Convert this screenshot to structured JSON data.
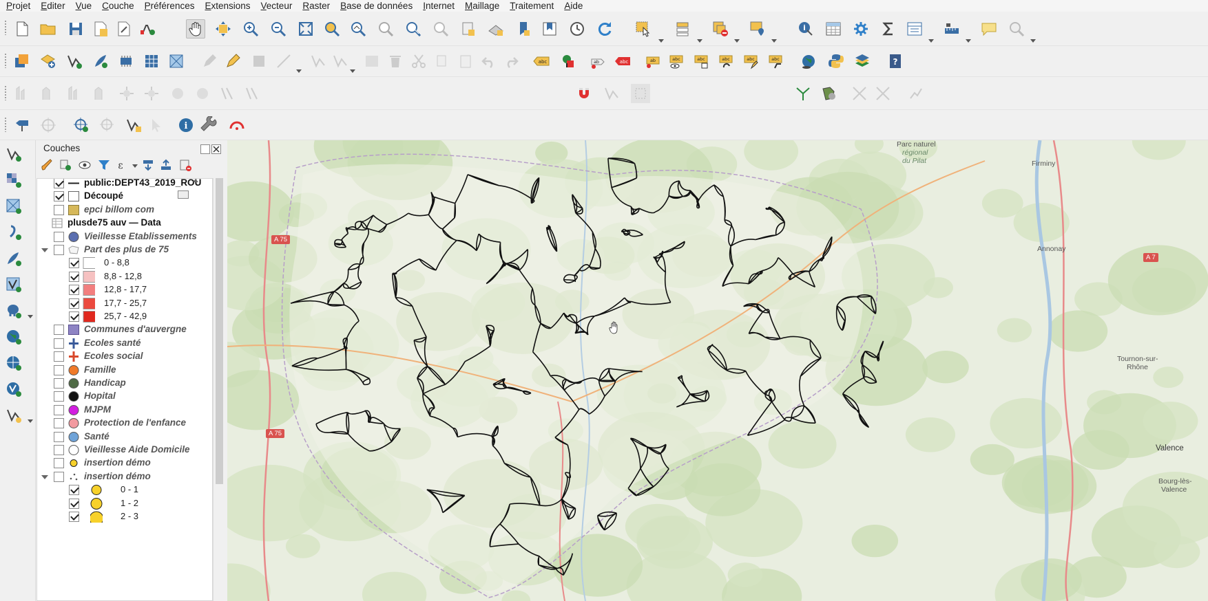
{
  "menu": [
    {
      "first": "P",
      "rest": "rojet"
    },
    {
      "first": "E",
      "rest": "diter"
    },
    {
      "first": "V",
      "rest": "ue"
    },
    {
      "first": "C",
      "rest": "ouche"
    },
    {
      "first": "P",
      "rest": "références"
    },
    {
      "first": "E",
      "rest": "xtensions"
    },
    {
      "first": "V",
      "rest": "ecteur"
    },
    {
      "first": "R",
      "rest": "aster"
    },
    {
      "first": "B",
      "rest": "ase de données"
    },
    {
      "first": "I",
      "rest": "nternet"
    },
    {
      "first": "M",
      "rest": "aillage"
    },
    {
      "first": "T",
      "rest": "raitement"
    },
    {
      "first": "A",
      "rest": "ide"
    }
  ],
  "snapping": {
    "tolerance": "12",
    "unit": "px"
  },
  "layers_panel": {
    "title": "Couches"
  },
  "layers": [
    {
      "label": "public:DEPT43_2019_ROU",
      "checked": true,
      "style": "b",
      "sym": "line",
      "indent": 0
    },
    {
      "label": "Découpé",
      "checked": true,
      "style": "b",
      "sym": "emptybox",
      "indent": 0
    },
    {
      "label": "epci billom com",
      "checked": false,
      "style": "it",
      "sym": "box-khaki",
      "indent": 0
    },
    {
      "label": "plusde75 auv — Data",
      "checked": null,
      "style": "b",
      "sym": "table",
      "indent": 0
    },
    {
      "label": "Vieillesse Etablissements",
      "checked": false,
      "style": "it",
      "sym": "dot-blue",
      "indent": 0
    },
    {
      "label": "Part des plus de 75",
      "checked": false,
      "style": "it",
      "sym": "poly-white",
      "indent": 0,
      "expanded": true
    },
    {
      "label": "0 - 8,8",
      "checked": true,
      "style": "n",
      "sym": "swatch-0",
      "indent": 1
    },
    {
      "label": "8,8 - 12,8",
      "checked": true,
      "style": "n",
      "sym": "swatch-1",
      "indent": 1
    },
    {
      "label": "12,8 - 17,7",
      "checked": true,
      "style": "n",
      "sym": "swatch-2",
      "indent": 1
    },
    {
      "label": "17,7 - 25,7",
      "checked": true,
      "style": "n",
      "sym": "swatch-3",
      "indent": 1
    },
    {
      "label": "25,7 - 42,9",
      "checked": true,
      "style": "n",
      "sym": "swatch-4",
      "indent": 1
    },
    {
      "label": "Communes d'auvergne",
      "checked": false,
      "style": "it",
      "sym": "box-purple",
      "indent": 0
    },
    {
      "label": "Ecoles santé",
      "checked": false,
      "style": "it",
      "sym": "cross-blue",
      "indent": 0
    },
    {
      "label": "Ecoles social",
      "checked": false,
      "style": "it",
      "sym": "cross-red",
      "indent": 0
    },
    {
      "label": "Famille",
      "checked": false,
      "style": "it",
      "sym": "dot-orange",
      "indent": 0
    },
    {
      "label": "Handicap",
      "checked": false,
      "style": "it",
      "sym": "dot-green",
      "indent": 0
    },
    {
      "label": "Hopital",
      "checked": false,
      "style": "it",
      "sym": "dot-black",
      "indent": 0
    },
    {
      "label": "MJPM",
      "checked": false,
      "style": "it",
      "sym": "dot-magenta",
      "indent": 0
    },
    {
      "label": "Protection de l'enfance",
      "checked": false,
      "style": "it",
      "sym": "dot-pink",
      "indent": 0
    },
    {
      "label": "Santé",
      "checked": false,
      "style": "it",
      "sym": "dot-lightblue",
      "indent": 0
    },
    {
      "label": "Vieillesse Aide Domicile",
      "checked": false,
      "style": "it",
      "sym": "dot-white",
      "indent": 0
    },
    {
      "label": "insertion démo",
      "checked": false,
      "style": "it",
      "sym": "dot-yellow-small",
      "indent": 0
    },
    {
      "label": "insertion démo",
      "checked": false,
      "style": "it",
      "sym": "dots-scatter",
      "indent": 0,
      "expanded": true
    },
    {
      "label": "0 - 1",
      "checked": true,
      "style": "n",
      "sym": "yellow-1",
      "indent": 1
    },
    {
      "label": "1 - 2",
      "checked": true,
      "style": "n",
      "sym": "yellow-2",
      "indent": 1
    },
    {
      "label": "2 - 3",
      "checked": true,
      "style": "n",
      "sym": "yellow-3",
      "indent": 1
    }
  ],
  "colors": {
    "swatch-0": "#ffffff",
    "swatch-1": "#f6c1c1",
    "swatch-2": "#f27f7f",
    "swatch-3": "#eb4a3f",
    "swatch-4": "#e0291f",
    "road": "#111111",
    "map_bg": "#e9eee0"
  },
  "map_labels": {
    "park": "Parc naturel",
    "park2": "régional",
    "park3": "du Pilat",
    "firminy": "Firminy",
    "annonay": "Annonay",
    "tournon": "Tournon-sur-",
    "tournon2": "Rhône",
    "valence": "Valence",
    "bourg": "Bourg-lès-",
    "bourg2": "Valence",
    "a75a": "A 75",
    "a75b": "A 75",
    "a7": "A 7"
  }
}
